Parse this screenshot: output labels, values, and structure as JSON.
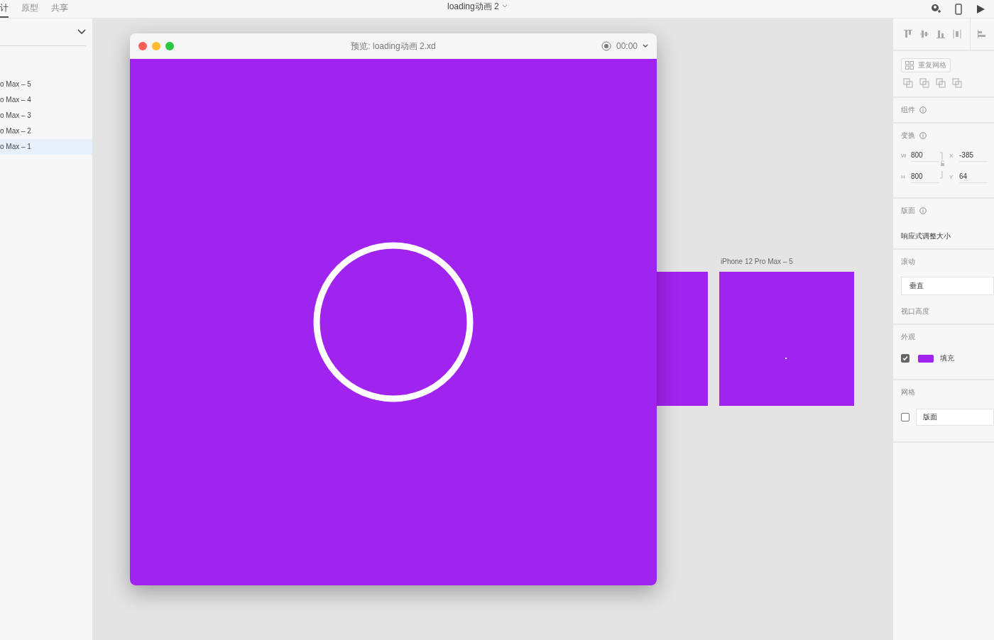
{
  "toolbar": {
    "tabs": [
      {
        "label": "计",
        "selected": true
      },
      {
        "label": "原型",
        "selected": false
      },
      {
        "label": "共享",
        "selected": false
      }
    ],
    "document_title": "loading动画 2"
  },
  "layers": [
    {
      "label": "o Max – 5",
      "selected": false
    },
    {
      "label": "o Max – 4",
      "selected": false
    },
    {
      "label": "o Max – 3",
      "selected": false
    },
    {
      "label": "o Max – 2",
      "selected": false
    },
    {
      "label": "o Max – 1",
      "selected": true
    }
  ],
  "preview": {
    "title": "预览: loading动画 2.xd",
    "time": "00:00"
  },
  "canvas": {
    "artboard_label": "iPhone 12 Pro Max – 5"
  },
  "inspector": {
    "repeat_grid": "重复网格",
    "component_label": "组件",
    "transform_label": "变换",
    "fields": [
      {
        "label": "W",
        "value": "800"
      },
      {
        "label": "X",
        "value": "-385"
      },
      {
        "label": "H",
        "value": "800"
      },
      {
        "label": "Y",
        "value": "64"
      }
    ],
    "board_label": "版面",
    "responsive": "响应式调整大小",
    "scroll_label": "滚动",
    "scroll_value": "垂直",
    "viewport_label": "视口高度",
    "appearance_label": "外观",
    "fill": {
      "checked": true,
      "color": "#a123f0",
      "label": "填充"
    },
    "grid_label": "网格",
    "grid": {
      "checked": false,
      "value": "版面"
    }
  }
}
